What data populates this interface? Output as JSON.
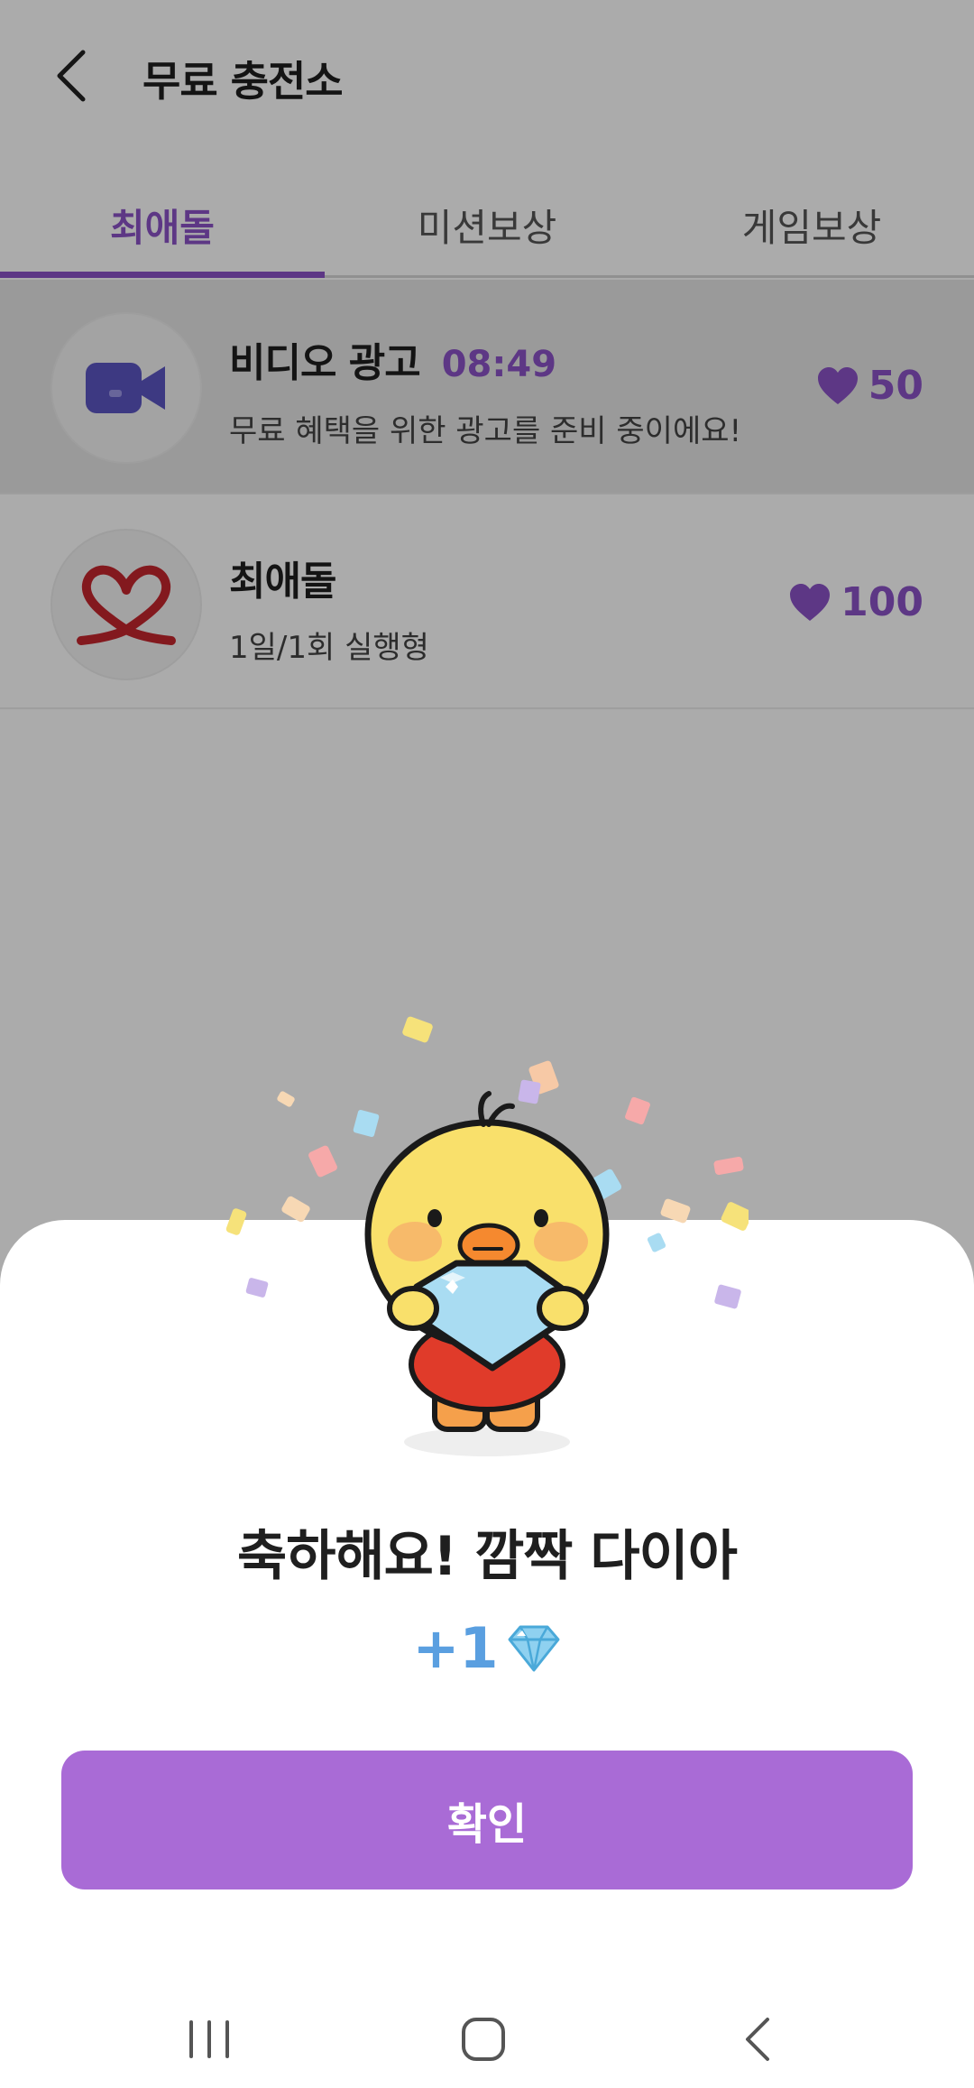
{
  "header": {
    "title": "무료 충전소"
  },
  "tabs": [
    {
      "label": "최애돌",
      "active": true
    },
    {
      "label": "미션보상",
      "active": false
    },
    {
      "label": "게임보상",
      "active": false
    }
  ],
  "items": [
    {
      "title": "비디오 광고",
      "timer": "08:49",
      "desc": "무료 혜택을 위한 광고를 준비 중이에요!",
      "reward": "50",
      "icon": "video-camera-icon"
    },
    {
      "title": "최애돌",
      "desc": "1일/1회 실행형",
      "reward": "100",
      "icon": "heart-ribbon-logo"
    }
  ],
  "modal": {
    "title": "축하해요! 깜짝 다이아",
    "amount": "+1",
    "amount_icon": "diamond-icon",
    "confirm_label": "확인"
  },
  "colors": {
    "accent": "#8b52c7",
    "button": "#a96bd6",
    "amount": "#5a9fe0"
  }
}
